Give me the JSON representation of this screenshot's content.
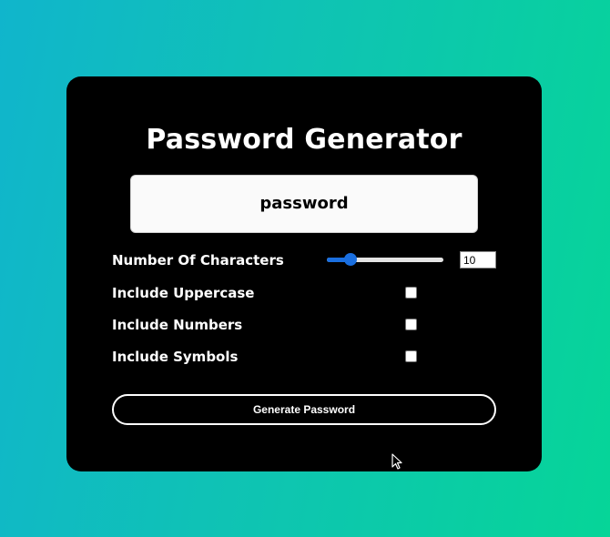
{
  "app": {
    "title": "Password Generator"
  },
  "result": {
    "value": "password"
  },
  "options": {
    "length": {
      "label": "Number Of Characters",
      "value": "10",
      "slider_fraction": 0.2
    },
    "uppercase": {
      "label": "Include Uppercase",
      "checked": false
    },
    "numbers": {
      "label": "Include Numbers",
      "checked": false
    },
    "symbols": {
      "label": "Include Symbols",
      "checked": false
    }
  },
  "actions": {
    "generate_label": "Generate Password"
  },
  "colors": {
    "background_start": "#10b5cc",
    "background_end": "#06d598",
    "card": "#000000",
    "accent": "#1a6fe0"
  },
  "icons": {
    "cursor": "mouse-pointer-icon"
  }
}
